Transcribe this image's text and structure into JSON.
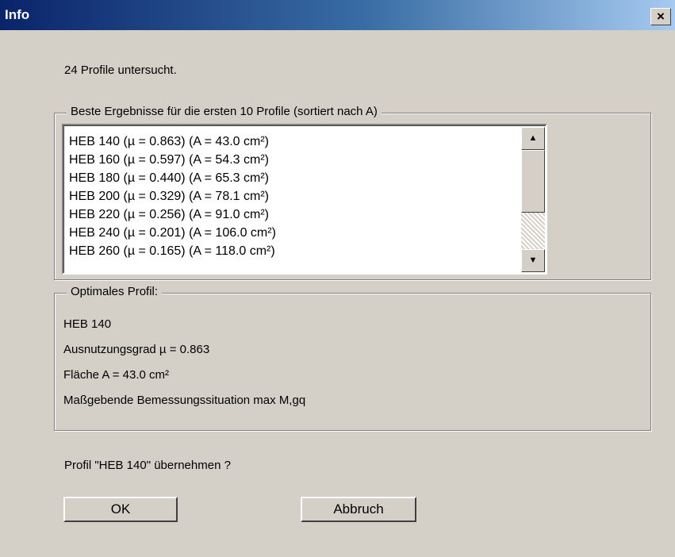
{
  "window": {
    "title": "Info",
    "close_label": "×"
  },
  "summary": "24 Profile untersucht.",
  "best": {
    "legend": "Beste Ergebnisse für die ersten 10 Profile (sortiert nach A)",
    "items": [
      "HEB 140 (µ = 0.863) (A = 43.0 cm²)",
      "HEB 160 (µ = 0.597) (A = 54.3 cm²)",
      "HEB 180 (µ = 0.440) (A = 65.3 cm²)",
      "HEB 200 (µ = 0.329) (A = 78.1 cm²)",
      "HEB 220 (µ = 0.256) (A = 91.0 cm²)",
      "HEB 240 (µ = 0.201) (A = 106.0 cm²)",
      "HEB 260 (µ = 0.165) (A = 118.0 cm²)"
    ],
    "scroll_up": "▲",
    "scroll_down": "▼"
  },
  "optimal": {
    "legend": "Optimales Profil:",
    "profile": "HEB 140",
    "utilization": "Ausnutzungsgrad µ = 0.863",
    "area": "Fläche A = 43.0 cm²",
    "situation": "Maßgebende Bemessungssituation max M,gq"
  },
  "question": "Profil \"HEB 140\" übernehmen ?",
  "buttons": {
    "ok": "OK",
    "cancel": "Abbruch"
  }
}
